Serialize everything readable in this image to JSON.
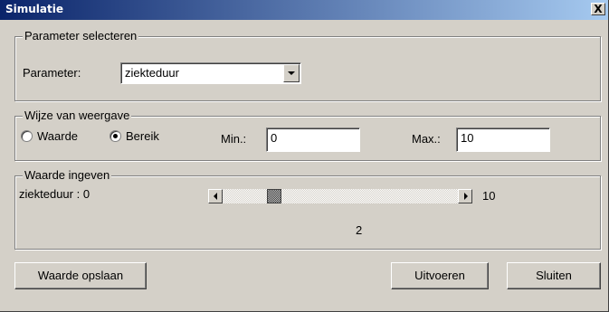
{
  "window": {
    "title": "Simulatie",
    "close_label": "X"
  },
  "parameter_group": {
    "legend": "Parameter selecteren",
    "label": "Parameter:",
    "selected": "ziekteduur"
  },
  "display_group": {
    "legend": "Wijze van weergave",
    "options": [
      {
        "label": "Waarde",
        "selected": false
      },
      {
        "label": "Bereik",
        "selected": true
      }
    ],
    "min_label": "Min.:",
    "min_value": "0",
    "max_label": "Max.:",
    "max_value": "10"
  },
  "value_group": {
    "legend": "Waarde ingeven",
    "param_label": "ziekteduur : 0",
    "slider_min": 0,
    "slider_max": 10,
    "slider_value": 2,
    "max_label": "10",
    "current_value": "2"
  },
  "buttons": {
    "save": "Waarde opslaan",
    "run": "Uitvoeren",
    "close": "Sluiten"
  }
}
